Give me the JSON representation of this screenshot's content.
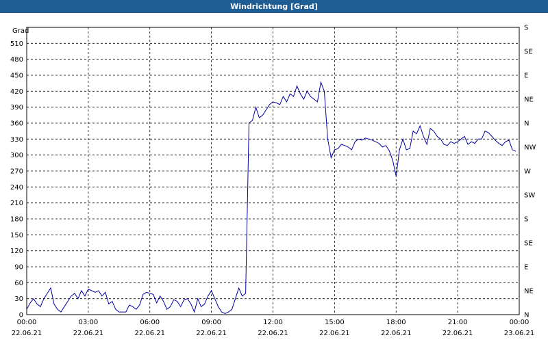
{
  "window": {
    "title": "Windrichtung [Grad]"
  },
  "chart_data": {
    "type": "line",
    "title": "Windrichtung [Grad]",
    "ylabel": "Grad",
    "xlabel": "",
    "ylim": [
      0,
      540
    ],
    "yticks": [
      0,
      30,
      60,
      90,
      120,
      150,
      180,
      210,
      240,
      270,
      300,
      330,
      360,
      390,
      420,
      450,
      480,
      510
    ],
    "xlim": [
      "2021-06-22 00:00",
      "2021-06-23 00:00"
    ],
    "xticks": [
      {
        "time": "00:00",
        "date": "22.06.21"
      },
      {
        "time": "03:00",
        "date": "22.06.21"
      },
      {
        "time": "06:00",
        "date": "22.06.21"
      },
      {
        "time": "09:00",
        "date": "22.06.21"
      },
      {
        "time": "12:00",
        "date": "22.06.21"
      },
      {
        "time": "15:00",
        "date": "22.06.21"
      },
      {
        "time": "18:00",
        "date": "22.06.21"
      },
      {
        "time": "21:00",
        "date": "22.06.21"
      },
      {
        "time": "00:00",
        "date": "23.06.21"
      }
    ],
    "right_ticks": [
      {
        "label": "N",
        "value": 0
      },
      {
        "label": "NE",
        "value": 45
      },
      {
        "label": "E",
        "value": 90
      },
      {
        "label": "SE",
        "value": 135
      },
      {
        "label": "S",
        "value": 180
      },
      {
        "label": "SW",
        "value": 225
      },
      {
        "label": "W",
        "value": 270
      },
      {
        "label": "NW",
        "value": 315
      },
      {
        "label": "N",
        "value": 360
      },
      {
        "label": "NE",
        "value": 405
      },
      {
        "label": "E",
        "value": 450
      },
      {
        "label": "SE",
        "value": 495
      },
      {
        "label": "S",
        "value": 540
      }
    ],
    "grid": true,
    "line_color": "#0000a0",
    "series": [
      {
        "x": [
          "00:00",
          "00:10",
          "00:20",
          "00:30",
          "00:40",
          "00:50",
          "01:00",
          "01:10",
          "01:20",
          "01:30",
          "01:40",
          "01:50",
          "02:00",
          "02:10",
          "02:20",
          "02:30",
          "02:40",
          "02:50",
          "03:00",
          "03:10",
          "03:20",
          "03:30",
          "03:40",
          "03:50",
          "04:00",
          "04:10",
          "04:20",
          "04:30",
          "04:40",
          "04:50",
          "05:00",
          "05:10",
          "05:20",
          "05:30",
          "05:40",
          "05:50",
          "06:00",
          "06:10",
          "06:20",
          "06:30",
          "06:40",
          "06:50",
          "07:00",
          "07:10",
          "07:20",
          "07:30",
          "07:40",
          "07:50",
          "08:00",
          "08:10",
          "08:20",
          "08:30",
          "08:40",
          "08:50",
          "09:00",
          "09:10",
          "09:20",
          "09:30",
          "09:40",
          "09:50",
          "10:00",
          "10:10",
          "10:20",
          "10:30",
          "10:40",
          "10:50",
          "11:00",
          "11:10",
          "11:20",
          "11:30",
          "11:40",
          "11:50",
          "12:00",
          "12:10",
          "12:20",
          "12:30",
          "12:40",
          "12:50",
          "13:00",
          "13:10",
          "13:20",
          "13:30",
          "13:40",
          "13:50",
          "14:00",
          "14:10",
          "14:20",
          "14:30",
          "14:40",
          "14:50",
          "15:00",
          "15:10",
          "15:20",
          "15:30",
          "15:40",
          "15:50",
          "16:00",
          "16:10",
          "16:20",
          "16:30",
          "16:40",
          "16:50",
          "17:00",
          "17:10",
          "17:20",
          "17:30",
          "17:40",
          "17:50",
          "18:00",
          "18:10",
          "18:20",
          "18:30",
          "18:40",
          "18:50",
          "19:00",
          "19:10",
          "19:20",
          "19:30",
          "19:40",
          "19:50",
          "20:00",
          "20:10",
          "20:20",
          "20:30",
          "20:40",
          "20:50",
          "21:00",
          "21:10",
          "21:20",
          "21:30",
          "21:40",
          "21:50",
          "22:00",
          "22:10",
          "22:20",
          "22:30",
          "22:40",
          "22:50",
          "23:00",
          "23:10",
          "23:20",
          "23:30",
          "23:40",
          "23:50"
        ],
        "values": [
          10,
          22,
          30,
          20,
          15,
          30,
          40,
          50,
          20,
          10,
          5,
          15,
          25,
          35,
          40,
          30,
          45,
          35,
          48,
          45,
          42,
          45,
          35,
          42,
          20,
          25,
          10,
          5,
          5,
          5,
          18,
          15,
          10,
          18,
          38,
          42,
          40,
          38,
          22,
          35,
          25,
          10,
          15,
          28,
          25,
          15,
          28,
          30,
          20,
          5,
          30,
          15,
          20,
          35,
          45,
          30,
          15,
          5,
          2,
          5,
          10,
          30,
          50,
          35,
          40,
          360,
          365,
          390,
          370,
          375,
          385,
          395,
          400,
          398,
          395,
          410,
          400,
          415,
          410,
          430,
          415,
          405,
          420,
          410,
          405,
          400,
          437,
          420,
          330,
          295,
          310,
          312,
          320,
          318,
          315,
          310,
          325,
          330,
          328,
          332,
          330,
          328,
          325,
          322,
          315,
          318,
          308,
          290,
          260,
          310,
          330,
          310,
          312,
          345,
          340,
          355,
          335,
          320,
          350,
          345,
          335,
          330,
          320,
          318,
          325,
          322,
          325,
          330,
          335,
          320,
          325,
          322,
          330,
          330,
          345,
          342,
          335,
          328,
          322,
          318,
          325,
          328,
          310,
          307
        ]
      }
    ]
  }
}
